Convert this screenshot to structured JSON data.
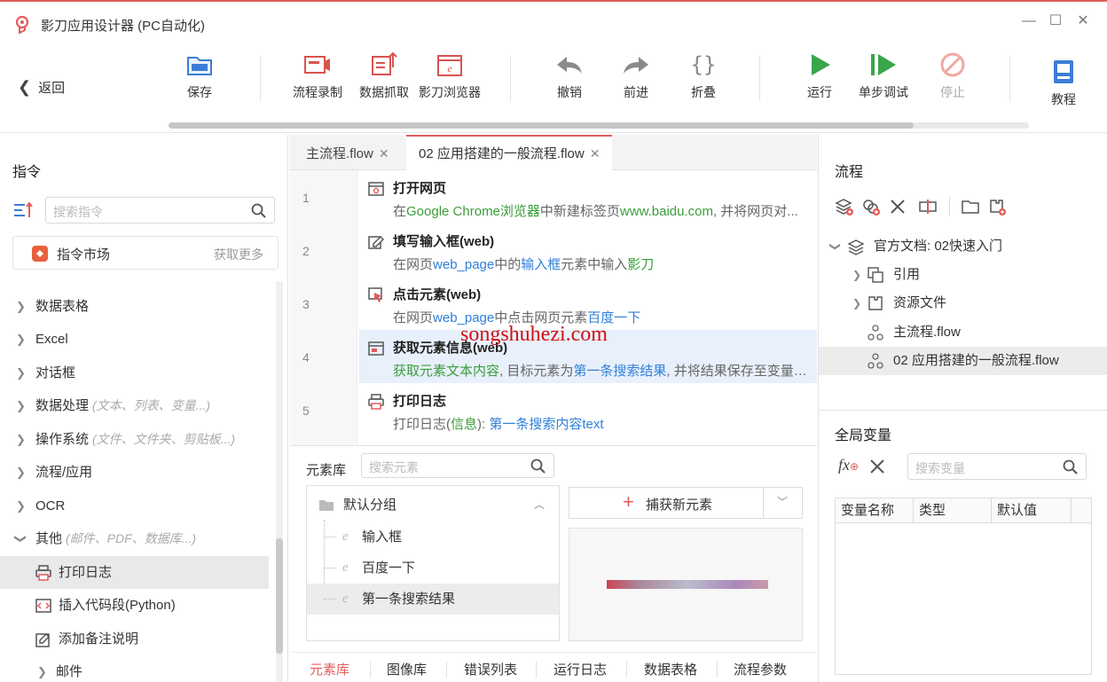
{
  "window": {
    "title": "影刀应用设计器 (PC自动化)",
    "controls": [
      "minimize",
      "maximize",
      "close"
    ]
  },
  "toolbar": {
    "back_label": "返回",
    "buttons": [
      {
        "label": "保存",
        "icon": "save-folder-icon"
      },
      {
        "label": "流程录制",
        "icon": "record-icon"
      },
      {
        "label": "数据抓取",
        "icon": "data-scrape-icon"
      },
      {
        "label": "影刀浏览器",
        "icon": "browser-icon"
      },
      {
        "label": "撤销",
        "icon": "undo-icon"
      },
      {
        "label": "前进",
        "icon": "redo-icon"
      },
      {
        "label": "折叠",
        "icon": "braces-icon"
      },
      {
        "label": "运行",
        "icon": "run-icon"
      },
      {
        "label": "单步调试",
        "icon": "step-debug-icon"
      },
      {
        "label": "停止",
        "icon": "stop-icon",
        "disabled": true
      },
      {
        "label": "教程",
        "icon": "tutorial-icon"
      }
    ]
  },
  "left_panel": {
    "title": "指令",
    "search_placeholder": "搜索指令",
    "market_label": "指令市场",
    "market_more": "获取更多",
    "tree": [
      {
        "label": "数据表格",
        "hint": "",
        "expanded": false
      },
      {
        "label": "Excel",
        "hint": "",
        "expanded": false
      },
      {
        "label": "对话框",
        "hint": "",
        "expanded": false
      },
      {
        "label": "数据处理",
        "hint": "(文本、列表、变量...)",
        "expanded": false
      },
      {
        "label": "操作系统",
        "hint": "(文件、文件夹、剪贴板...)",
        "expanded": false
      },
      {
        "label": "流程/应用",
        "hint": "",
        "expanded": false
      },
      {
        "label": "OCR",
        "hint": "",
        "expanded": false
      },
      {
        "label": "其他",
        "hint": "(邮件、PDF、数据库...)",
        "expanded": true
      }
    ],
    "sub_items": [
      {
        "label": "打印日志",
        "icon": "print-log-icon",
        "selected": true
      },
      {
        "label": "插入代码段(Python)",
        "icon": "code-icon",
        "selected": false
      },
      {
        "label": "添加备注说明",
        "icon": "note-icon",
        "selected": false
      }
    ],
    "sub_group": {
      "label": "邮件"
    }
  },
  "editor": {
    "tabs": [
      {
        "label": "主流程.flow",
        "active": false
      },
      {
        "label": "02 应用搭建的一般流程.flow",
        "active": true
      }
    ],
    "steps": [
      {
        "num": "1",
        "title": "打开网页",
        "desc_parts": [
          [
            "在",
            ""
          ],
          [
            "Google Chrome浏览器",
            "green"
          ],
          [
            "中新建标签页",
            ""
          ],
          [
            "www.baidu.com",
            "green"
          ],
          [
            ", 并将网页对...",
            ""
          ]
        ]
      },
      {
        "num": "2",
        "title": "填写输入框(web)",
        "desc_parts": [
          [
            "在网页",
            ""
          ],
          [
            "web_page",
            "blue"
          ],
          [
            "中的",
            ""
          ],
          [
            "输入框",
            "blue"
          ],
          [
            "元素中输入",
            ""
          ],
          [
            "影刀",
            "green"
          ]
        ]
      },
      {
        "num": "3",
        "title": "点击元素(web)",
        "desc_parts": [
          [
            "在网页",
            ""
          ],
          [
            "web_page",
            "blue"
          ],
          [
            "中点击网页元素",
            ""
          ],
          [
            "百度一下",
            "blue"
          ]
        ]
      },
      {
        "num": "4",
        "title": "获取元素信息(web)",
        "desc_parts": [
          [
            "获取元素文本内容",
            "green"
          ],
          [
            ", 目标元素为",
            ""
          ],
          [
            "第一条搜索结果",
            "blue"
          ],
          [
            ", 并将结果保存至变量",
            ""
          ],
          [
            "第...",
            "blue"
          ]
        ],
        "highlighted": true
      },
      {
        "num": "5",
        "title": "打印日志",
        "desc_parts": [
          [
            "打印日志(",
            ""
          ],
          [
            "信息",
            "green"
          ],
          [
            "):  ",
            ""
          ],
          [
            "第一条搜索内容text",
            "blue"
          ]
        ]
      }
    ],
    "watermark": "songshuhezi.com"
  },
  "element_library": {
    "label": "元素库",
    "search_placeholder": "搜索元素",
    "group_label": "默认分组",
    "elements": [
      {
        "label": "输入框",
        "selected": false
      },
      {
        "label": "百度一下",
        "selected": false
      },
      {
        "label": "第一条搜索结果",
        "selected": true
      }
    ],
    "capture_label": "捕获新元素"
  },
  "bottom_tabs": [
    {
      "label": "元素库",
      "active": true
    },
    {
      "label": "图像库",
      "active": false
    },
    {
      "label": "错误列表",
      "active": false
    },
    {
      "label": "运行日志",
      "active": false
    },
    {
      "label": "数据表格",
      "active": false
    },
    {
      "label": "流程参数",
      "active": false
    }
  ],
  "right_panel": {
    "title": "流程",
    "tree": [
      {
        "label": "官方文档: 02快速入门",
        "level": 0,
        "expanded": true
      },
      {
        "label": "引用",
        "level": 1,
        "expanded": false
      },
      {
        "label": "资源文件",
        "level": 1,
        "expanded": false
      },
      {
        "label": "主流程.flow",
        "level": 1
      },
      {
        "label": "02 应用搭建的一般流程.flow",
        "level": 1,
        "selected": true
      }
    ],
    "global_vars_title": "全局变量",
    "var_search_placeholder": "搜索变量",
    "var_columns": [
      "变量名称",
      "类型",
      "默认值"
    ]
  },
  "colors": {
    "accent": "#e25c5c",
    "run_green": "#3aa64a",
    "link_blue": "#2f7fd8",
    "value_green": "#3a9d3a",
    "toolbar_blue": "#3b7ed6"
  }
}
